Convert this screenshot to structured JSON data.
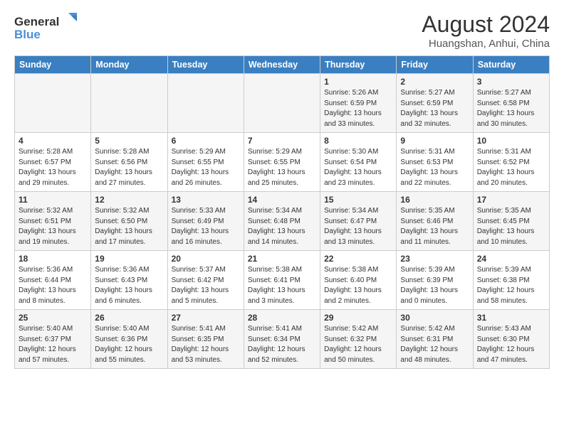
{
  "logo": {
    "line1": "General",
    "line2": "Blue"
  },
  "title": "August 2024",
  "subtitle": "Huangshan, Anhui, China",
  "headers": [
    "Sunday",
    "Monday",
    "Tuesday",
    "Wednesday",
    "Thursday",
    "Friday",
    "Saturday"
  ],
  "weeks": [
    [
      {
        "day": "",
        "info": ""
      },
      {
        "day": "",
        "info": ""
      },
      {
        "day": "",
        "info": ""
      },
      {
        "day": "",
        "info": ""
      },
      {
        "day": "1",
        "info": "Sunrise: 5:26 AM\nSunset: 6:59 PM\nDaylight: 13 hours\nand 33 minutes."
      },
      {
        "day": "2",
        "info": "Sunrise: 5:27 AM\nSunset: 6:59 PM\nDaylight: 13 hours\nand 32 minutes."
      },
      {
        "day": "3",
        "info": "Sunrise: 5:27 AM\nSunset: 6:58 PM\nDaylight: 13 hours\nand 30 minutes."
      }
    ],
    [
      {
        "day": "4",
        "info": "Sunrise: 5:28 AM\nSunset: 6:57 PM\nDaylight: 13 hours\nand 29 minutes."
      },
      {
        "day": "5",
        "info": "Sunrise: 5:28 AM\nSunset: 6:56 PM\nDaylight: 13 hours\nand 27 minutes."
      },
      {
        "day": "6",
        "info": "Sunrise: 5:29 AM\nSunset: 6:55 PM\nDaylight: 13 hours\nand 26 minutes."
      },
      {
        "day": "7",
        "info": "Sunrise: 5:29 AM\nSunset: 6:55 PM\nDaylight: 13 hours\nand 25 minutes."
      },
      {
        "day": "8",
        "info": "Sunrise: 5:30 AM\nSunset: 6:54 PM\nDaylight: 13 hours\nand 23 minutes."
      },
      {
        "day": "9",
        "info": "Sunrise: 5:31 AM\nSunset: 6:53 PM\nDaylight: 13 hours\nand 22 minutes."
      },
      {
        "day": "10",
        "info": "Sunrise: 5:31 AM\nSunset: 6:52 PM\nDaylight: 13 hours\nand 20 minutes."
      }
    ],
    [
      {
        "day": "11",
        "info": "Sunrise: 5:32 AM\nSunset: 6:51 PM\nDaylight: 13 hours\nand 19 minutes."
      },
      {
        "day": "12",
        "info": "Sunrise: 5:32 AM\nSunset: 6:50 PM\nDaylight: 13 hours\nand 17 minutes."
      },
      {
        "day": "13",
        "info": "Sunrise: 5:33 AM\nSunset: 6:49 PM\nDaylight: 13 hours\nand 16 minutes."
      },
      {
        "day": "14",
        "info": "Sunrise: 5:34 AM\nSunset: 6:48 PM\nDaylight: 13 hours\nand 14 minutes."
      },
      {
        "day": "15",
        "info": "Sunrise: 5:34 AM\nSunset: 6:47 PM\nDaylight: 13 hours\nand 13 minutes."
      },
      {
        "day": "16",
        "info": "Sunrise: 5:35 AM\nSunset: 6:46 PM\nDaylight: 13 hours\nand 11 minutes."
      },
      {
        "day": "17",
        "info": "Sunrise: 5:35 AM\nSunset: 6:45 PM\nDaylight: 13 hours\nand 10 minutes."
      }
    ],
    [
      {
        "day": "18",
        "info": "Sunrise: 5:36 AM\nSunset: 6:44 PM\nDaylight: 13 hours\nand 8 minutes."
      },
      {
        "day": "19",
        "info": "Sunrise: 5:36 AM\nSunset: 6:43 PM\nDaylight: 13 hours\nand 6 minutes."
      },
      {
        "day": "20",
        "info": "Sunrise: 5:37 AM\nSunset: 6:42 PM\nDaylight: 13 hours\nand 5 minutes."
      },
      {
        "day": "21",
        "info": "Sunrise: 5:38 AM\nSunset: 6:41 PM\nDaylight: 13 hours\nand 3 minutes."
      },
      {
        "day": "22",
        "info": "Sunrise: 5:38 AM\nSunset: 6:40 PM\nDaylight: 13 hours\nand 2 minutes."
      },
      {
        "day": "23",
        "info": "Sunrise: 5:39 AM\nSunset: 6:39 PM\nDaylight: 13 hours\nand 0 minutes."
      },
      {
        "day": "24",
        "info": "Sunrise: 5:39 AM\nSunset: 6:38 PM\nDaylight: 12 hours\nand 58 minutes."
      }
    ],
    [
      {
        "day": "25",
        "info": "Sunrise: 5:40 AM\nSunset: 6:37 PM\nDaylight: 12 hours\nand 57 minutes."
      },
      {
        "day": "26",
        "info": "Sunrise: 5:40 AM\nSunset: 6:36 PM\nDaylight: 12 hours\nand 55 minutes."
      },
      {
        "day": "27",
        "info": "Sunrise: 5:41 AM\nSunset: 6:35 PM\nDaylight: 12 hours\nand 53 minutes."
      },
      {
        "day": "28",
        "info": "Sunrise: 5:41 AM\nSunset: 6:34 PM\nDaylight: 12 hours\nand 52 minutes."
      },
      {
        "day": "29",
        "info": "Sunrise: 5:42 AM\nSunset: 6:32 PM\nDaylight: 12 hours\nand 50 minutes."
      },
      {
        "day": "30",
        "info": "Sunrise: 5:42 AM\nSunset: 6:31 PM\nDaylight: 12 hours\nand 48 minutes."
      },
      {
        "day": "31",
        "info": "Sunrise: 5:43 AM\nSunset: 6:30 PM\nDaylight: 12 hours\nand 47 minutes."
      }
    ]
  ]
}
